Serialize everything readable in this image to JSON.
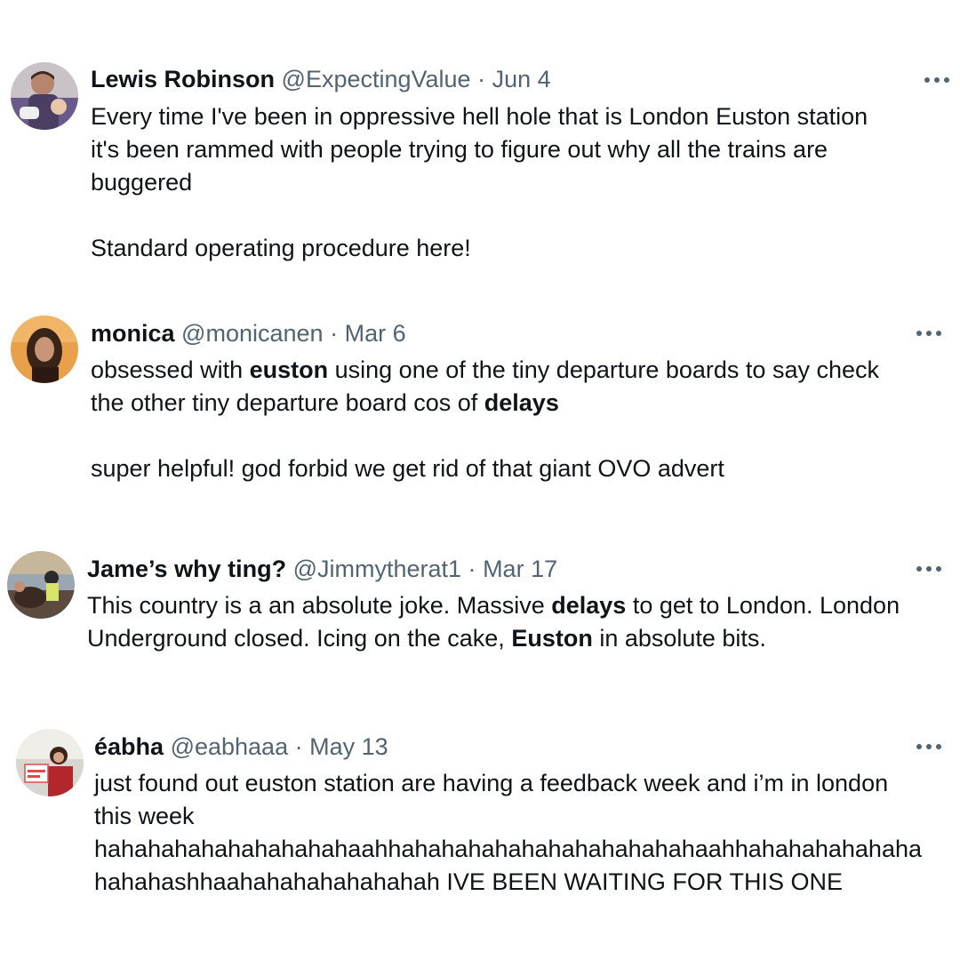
{
  "tweets": [
    {
      "name": "Lewis Robinson",
      "handle": "@ExpectingValue",
      "date": "Jun 4",
      "separator": "·",
      "more": "more-options",
      "lines": [
        "Every time I've been in oppressive hell hole that is London Euston station",
        "it's been rammed with people trying to figure out why all the trains are",
        "buggered",
        "",
        "Standard operating procedure here!"
      ]
    },
    {
      "name": "monica",
      "handle": "@monicanen",
      "date": "Mar 6",
      "separator": "·",
      "line1": [
        "obsessed with ",
        "euston",
        " using one of the tiny departure boards to say check"
      ],
      "line2": [
        "the other tiny departure board cos of ",
        "delays"
      ],
      "line3": "super helpful! god forbid we get rid of that giant OVO advert"
    },
    {
      "name": "Jame’s why ting?",
      "handle": "@Jimmytherat1",
      "date": "Mar 17",
      "separator": "·",
      "line1": [
        "This country is a an absolute joke. Massive ",
        "delays",
        " to get to London. London"
      ],
      "line2": [
        "Underground closed. Icing on the cake, ",
        "Euston",
        " in absolute bits."
      ]
    },
    {
      "name": "éabha",
      "handle": "@eabhaaa",
      "date": "May 13",
      "separator": "·",
      "lines": [
        "just found out euston station are having a feedback week and i’m in london",
        "this week",
        "hahahahahahahahahahaahhahahahahahahahahahahahaahhahahahahahaha",
        "hahahashhaahahahahahahahah IVE BEEN WAITING FOR THIS ONE"
      ]
    }
  ],
  "icons": {
    "more": "more-horizontal-icon",
    "avatar": "avatar-photo"
  },
  "colors": {
    "text": "#0f1419",
    "secondary": "#536471",
    "background": "#ffffff"
  }
}
